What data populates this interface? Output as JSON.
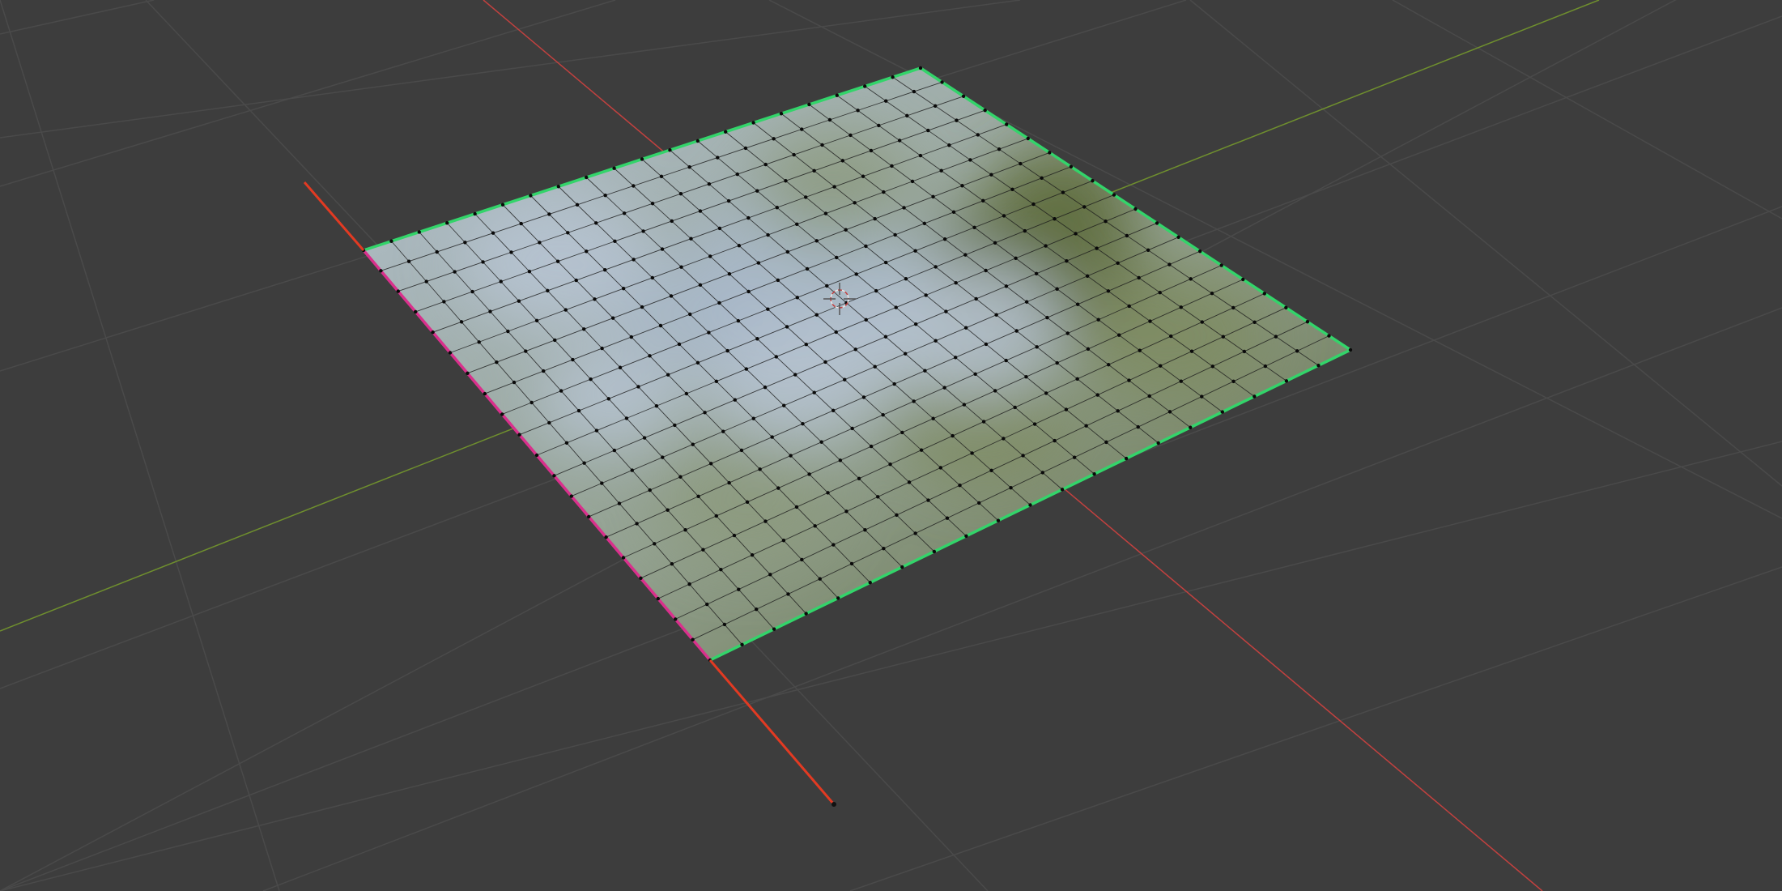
{
  "viewport": {
    "background": "#3d3d3d",
    "grid_line_color": "#4a4a4a",
    "x_axis_color": "#c2413f",
    "y_axis_color": "#6f8f2e"
  },
  "mesh": {
    "subdivisions": 20,
    "vertex_color": "#0a0a0a",
    "edge_color": "#1b1b1b",
    "boundary_edge_color": "#33d46a",
    "seam_edge_color": "#d9308c",
    "texture_colors": [
      "#b7c4d4",
      "#a9b9c9",
      "#7e8b62",
      "#5d6b3b",
      "#8c9a7e"
    ]
  },
  "gizmos": {
    "cursor": "3d-cursor",
    "transform_axis_color": "#e23a22"
  }
}
